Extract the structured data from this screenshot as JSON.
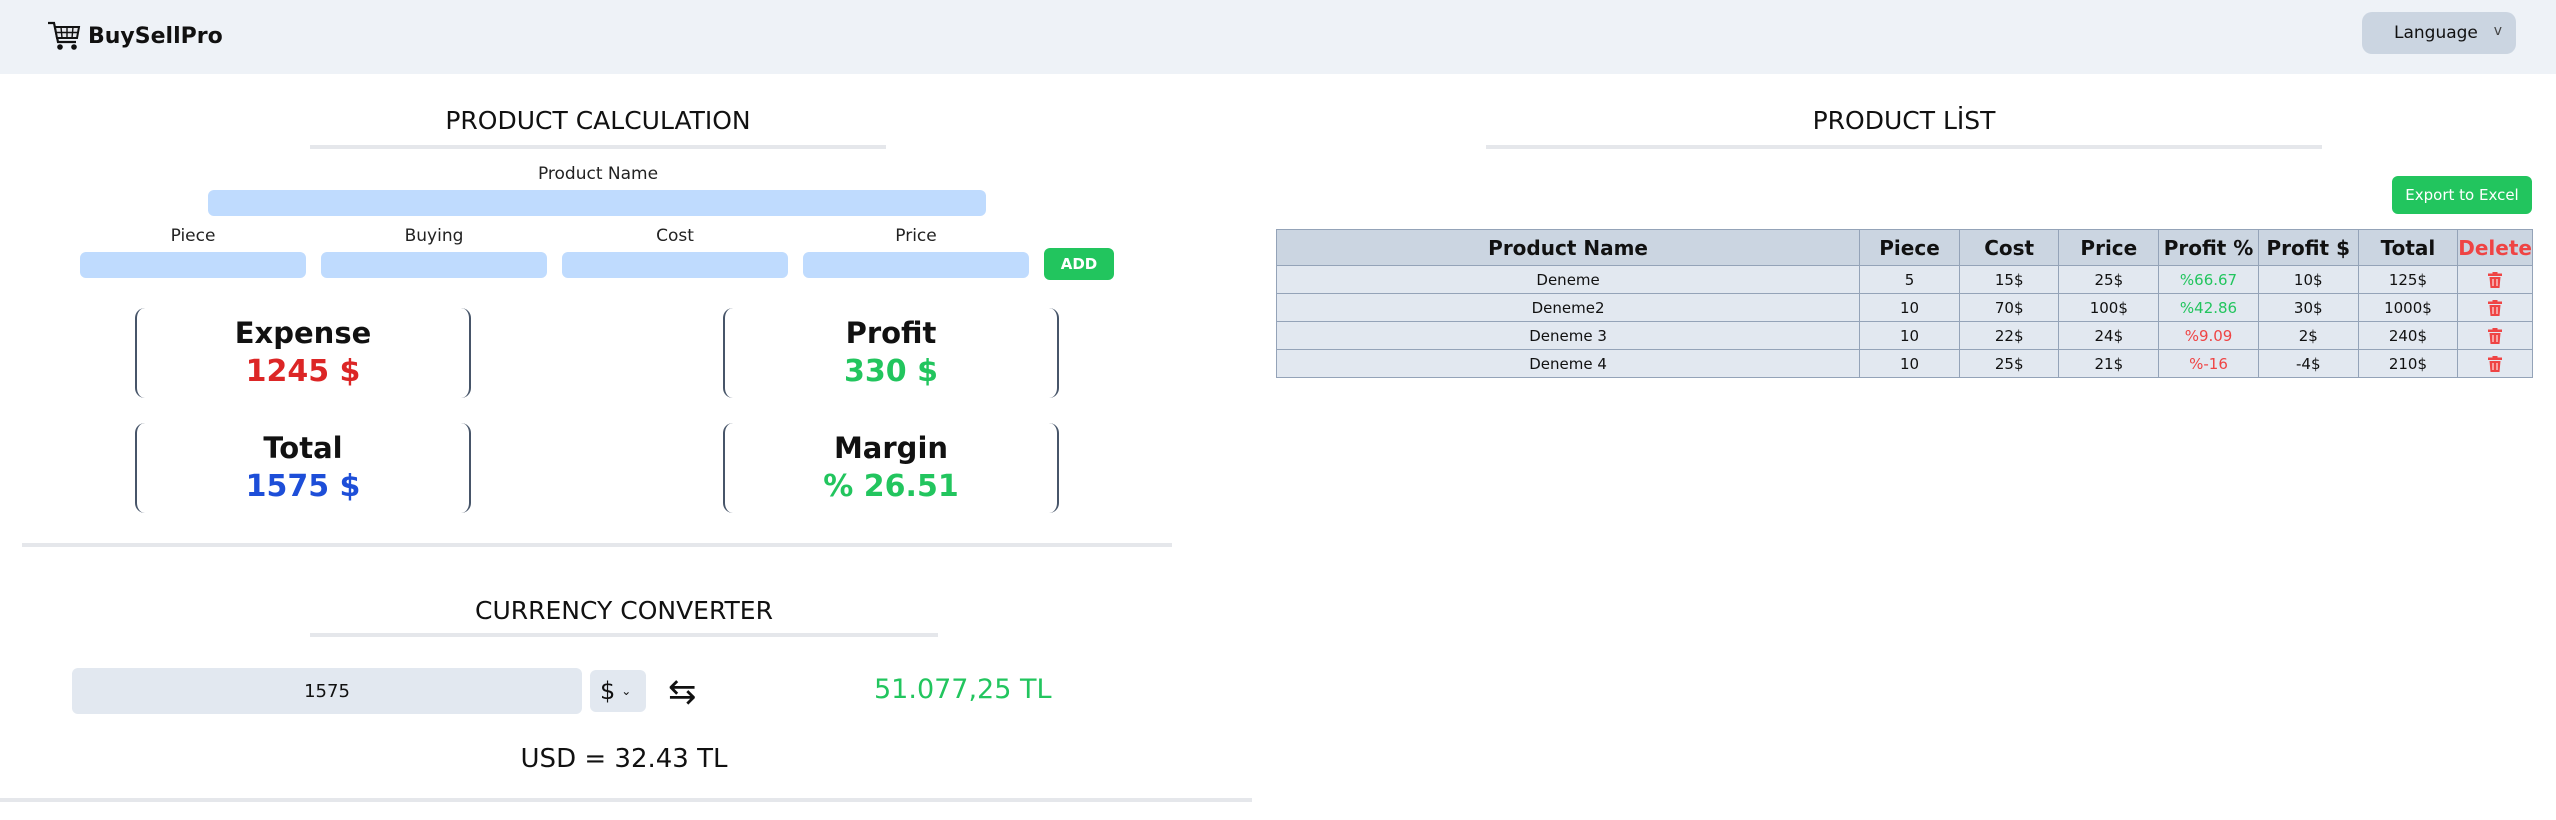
{
  "app": {
    "name": "BuySellPro",
    "logo_icon": "cart-icon"
  },
  "header": {
    "language_label": "Language",
    "language_chevron": "v"
  },
  "calculation": {
    "title": "PRODUCT CALCULATION",
    "product_name_label": "Product Name",
    "piece_label": "Piece",
    "buying_label": "Buying",
    "cost_label": "Cost",
    "price_label": "Price",
    "add_label": "ADD",
    "cards": {
      "expense": {
        "title": "Expense",
        "value": "1245 $",
        "color": "#dc2626"
      },
      "profit": {
        "title": "Profit",
        "value": "330 $",
        "color": "#22c55e"
      },
      "total": {
        "title": "Total",
        "value": "1575 $",
        "color": "#1d4ed8"
      },
      "margin": {
        "title": "Margin",
        "value": "% 26.51",
        "color": "#22c55e"
      }
    }
  },
  "converter": {
    "title": "CURRENCY CONVERTER",
    "amount": "1575",
    "currency": "$",
    "result": "51.077,25 TL",
    "rate_text": "USD = 32.43 TL"
  },
  "product_list": {
    "title": "PRODUCT LİST",
    "export_label": "Export to Excel",
    "columns": [
      "Product Name",
      "Piece",
      "Cost",
      "Price",
      "Profit %",
      "Profit $",
      "Total",
      "Delete"
    ],
    "rows": [
      {
        "name": "Deneme",
        "piece": "5",
        "cost": "15$",
        "price": "25$",
        "profit_pct": "%66.67",
        "profit_usd": "10$",
        "total": "125$"
      },
      {
        "name": "Deneme2",
        "piece": "10",
        "cost": "70$",
        "price": "100$",
        "profit_pct": "%42.86",
        "profit_usd": "30$",
        "total": "1000$"
      },
      {
        "name": "Deneme 3",
        "piece": "10",
        "cost": "22$",
        "price": "24$",
        "profit_pct": "%9.09",
        "profit_usd": "2$",
        "total": "240$"
      },
      {
        "name": "Deneme 4",
        "piece": "10",
        "cost": "25$",
        "price": "21$",
        "profit_pct": "%-16",
        "profit_usd": "-4$",
        "total": "210$"
      }
    ],
    "profit_pct_colors": [
      "#22c55e",
      "#22c55e",
      "#ef4444",
      "#ef4444"
    ]
  },
  "colors": {
    "accent_green": "#22c55e",
    "danger_red": "#ef4444",
    "input_blue": "#bfdbfe"
  }
}
